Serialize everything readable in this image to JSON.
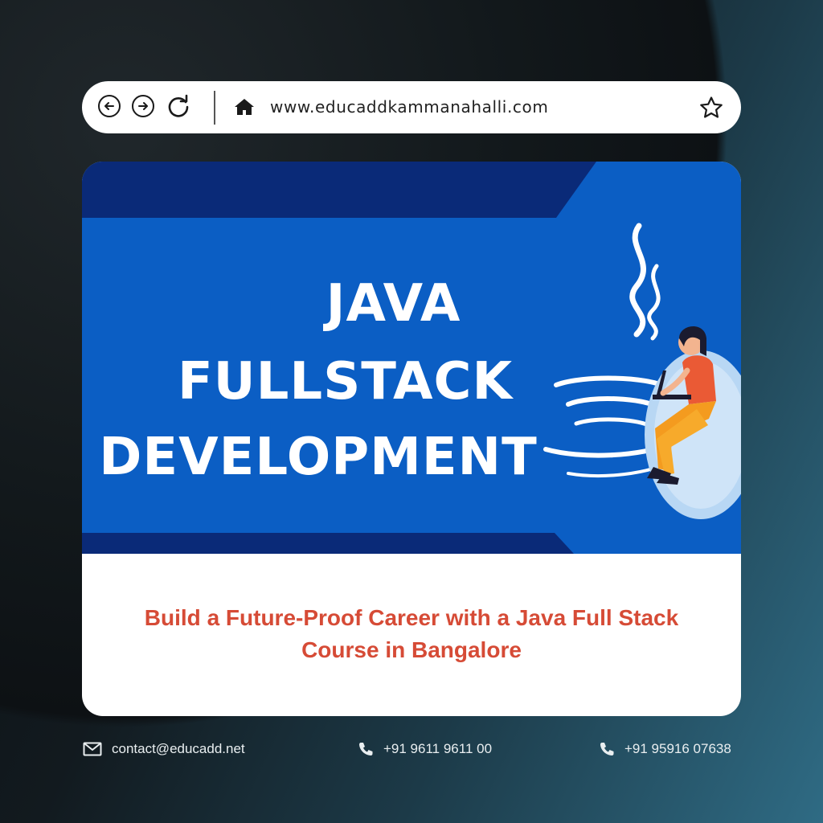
{
  "browser": {
    "url": "www.educaddkammanahalli.com",
    "icons": [
      "back-icon",
      "forward-icon",
      "refresh-icon",
      "home-icon",
      "star-icon"
    ]
  },
  "banner": {
    "title_line1": "JAVA",
    "title_line2": "FULLSTACK",
    "title_line3": "DEVELOPMENT",
    "tagline": "Build a Future-Proof Career with a Java Full Stack Course in Bangalore"
  },
  "footer": {
    "email": "contact@educadd.net",
    "phone1": "+91 9611 9611 00",
    "phone2": "+91 95916 07638"
  },
  "colors": {
    "banner_blue": "#0b5ec4",
    "dark_navy": "#0a2a78",
    "tagline_red": "#d64b36"
  }
}
